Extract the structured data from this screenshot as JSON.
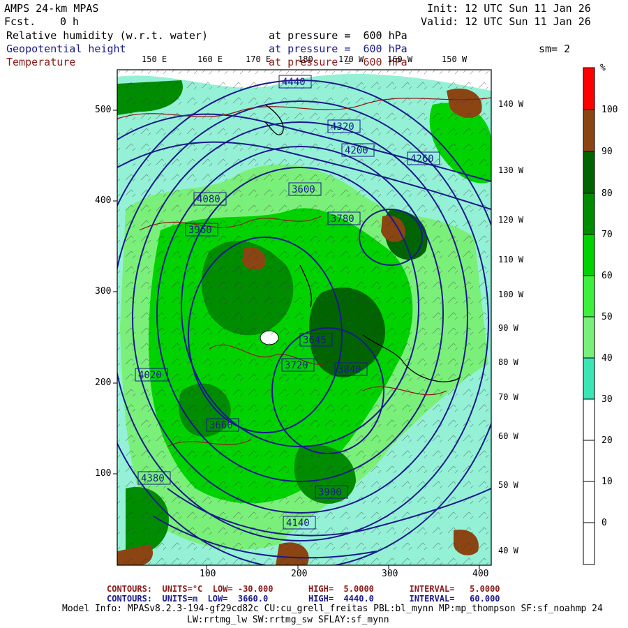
{
  "header": {
    "model": "AMPS 24-km MPAS",
    "fcst_label": "Fcst.",
    "fcst_value": "0 h",
    "init": "Init: 12 UTC Sun 11 Jan 26",
    "valid": "Valid: 12 UTC Sun 11 Jan 26",
    "smoothing": "sm= 2"
  },
  "fields": [
    {
      "name": "Relative humidity (w.r.t. water)",
      "level": "at pressure =  600 hPa",
      "color": "#000000"
    },
    {
      "name": "Geopotential height",
      "level": "at pressure =  600 hPa",
      "color": "#1a1a8c"
    },
    {
      "name": "Temperature",
      "level": "at pressure =  600 hPa",
      "color": "#8b1a1a"
    }
  ],
  "top_lon_labels": [
    "150 E",
    "160 E",
    "170 E",
    "180",
    "170 W",
    "160 W",
    "150 W"
  ],
  "right_lon_labels": [
    "140 W",
    "130 W",
    "120 W",
    "110 W",
    "100 W",
    "90 W",
    "80 W",
    "70 W",
    "60 W",
    "50 W",
    "40 W"
  ],
  "y_ticks": [
    "500",
    "400",
    "300",
    "200",
    "100"
  ],
  "x_ticks": [
    "100",
    "200",
    "300",
    "400"
  ],
  "colorbar": {
    "unit": "%",
    "labels": [
      "100",
      "90",
      "80",
      "70",
      "60",
      "50",
      "40",
      "30",
      "20",
      "10",
      "0"
    ],
    "colors": [
      "#ff0000",
      "#8b4513",
      "#006400",
      "#008c00",
      "#00d200",
      "#3cf03c",
      "#7af07a",
      "#3ce6b4",
      "#ffffff",
      "#ffffff",
      "#ffffff",
      "#ffffff"
    ]
  },
  "height_labels": [
    "4440",
    "4320",
    "4200",
    "4080",
    "3960",
    "3900",
    "3840",
    "3780",
    "3720",
    "3660",
    "4140",
    "4260",
    "4380",
    "4020",
    "3600",
    "3645"
  ],
  "footer": {
    "temp_contours": "CONTOURS:  UNITS=°C  LOW= -30.000       HIGH=  5.0000       INTERVAL=   5.0000",
    "height_contours": "CONTOURS:  UNITS=m  LOW=  3660.0        HIGH=  4440.0       INTERVAL=   60.000",
    "model_info": "Model Info: MPASv8.2.3-194-gf29cd82c CU:cu_grell_freitas PBL:bl_mynn MP:mp_thompson SF:sf_noahmp 24",
    "model_info2": "LW:rrtmg_lw SW:rrtmg_sw SFLAY:sf_mynn"
  }
}
